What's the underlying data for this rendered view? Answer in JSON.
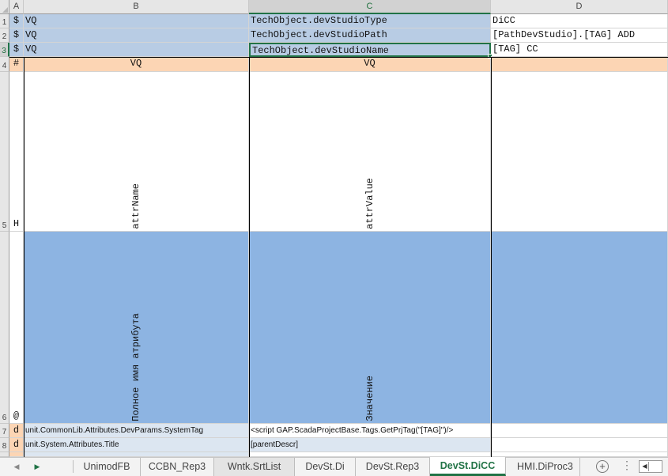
{
  "columns": [
    {
      "letter": "A"
    },
    {
      "letter": "B"
    },
    {
      "letter": "C"
    },
    {
      "letter": "D"
    }
  ],
  "rows": {
    "r1": {
      "num": "1",
      "a": "$",
      "b": "VQ",
      "c": "TechObject.devStudioType",
      "d": "DiCC"
    },
    "r2": {
      "num": "2",
      "a": "$",
      "b": "VQ",
      "c": "TechObject.devStudioPath",
      "d": "[PathDevStudio].[TAG] ADD"
    },
    "r3": {
      "num": "3",
      "a": "$",
      "b": "VQ",
      "c": "TechObject.devStudioName",
      "d": "[TAG] CC"
    },
    "r4": {
      "num": "4",
      "a": "#",
      "b": "VQ",
      "c": "VQ"
    },
    "r5": {
      "num": "5",
      "a": "H",
      "b": "attrName",
      "c": "attrValue"
    },
    "r6": {
      "num": "6",
      "a": "@",
      "b": "Полное имя атрибута",
      "c": "Значение"
    },
    "r7": {
      "num": "7",
      "a": "d",
      "b": "unit.CommonLib.Attributes.DevParams.SystemTag",
      "c": "<script GAP.ScadaProjectBase.Tags.GetPrjTag(\"[TAG]\")/>"
    },
    "r8": {
      "num": "8",
      "a": "d",
      "b": "unit.System.Attributes.Title",
      "c": "[parentDescr]"
    }
  },
  "tabs": [
    {
      "label": "UnimodFB"
    },
    {
      "label": "CCBN_Rep3"
    },
    {
      "label": "Wntk.SrtList"
    },
    {
      "label": "DevSt.Di"
    },
    {
      "label": "DevSt.Rep3"
    },
    {
      "label": "DevSt.DiCC"
    },
    {
      "label": "HMI.DiProc3"
    }
  ],
  "active_tab": "DevSt.DiCC",
  "colors": {
    "header_blue": "#b8cce4",
    "row6_blue": "#8db4e2",
    "row4_orange": "#fcd5b4",
    "data_row_blue": "#dce6f1",
    "accent_green": "#217346"
  }
}
